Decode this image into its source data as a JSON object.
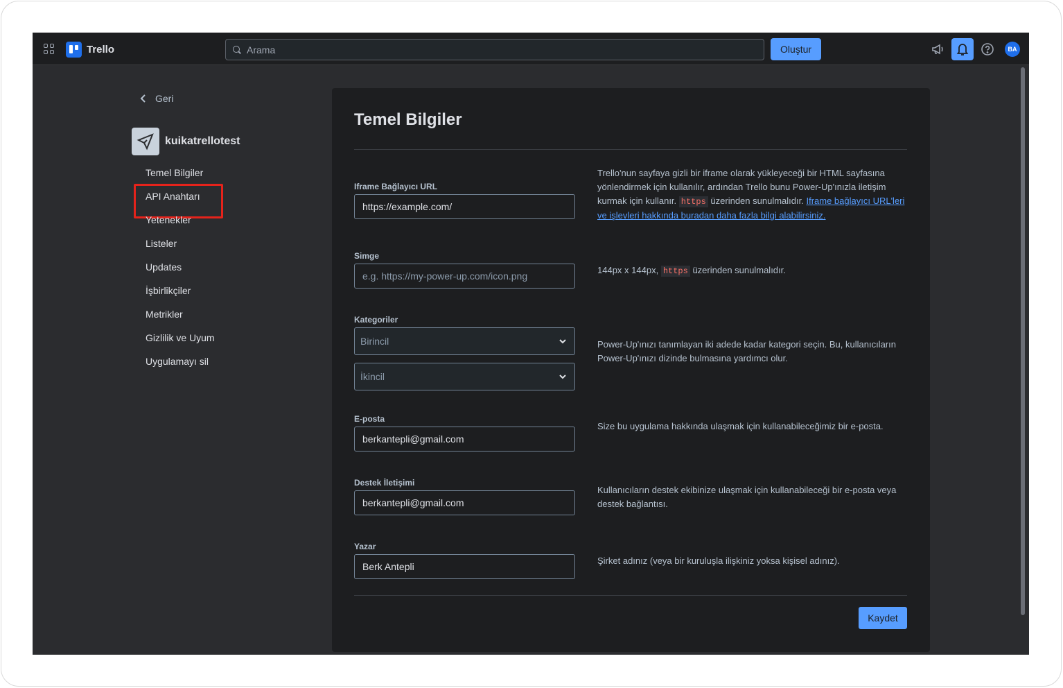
{
  "topbar": {
    "app_name": "Trello",
    "search_placeholder": "Arama",
    "create_label": "Oluştur",
    "avatar_initials": "BA"
  },
  "sidebar": {
    "back_label": "Geri",
    "app_name": "kuikatrellotest",
    "items": [
      {
        "label": "Temel Bilgiler"
      },
      {
        "label": "API Anahtarı"
      },
      {
        "label": "Yetenekler"
      },
      {
        "label": "Listeler"
      },
      {
        "label": "Updates"
      },
      {
        "label": "İşbirlikçiler"
      },
      {
        "label": "Metrikler"
      },
      {
        "label": "Gizlilik ve Uyum"
      },
      {
        "label": "Uygulamayı sil"
      }
    ]
  },
  "main": {
    "title": "Temel Bilgiler",
    "iframe": {
      "label": "Iframe Bağlayıcı URL",
      "value": "https://example.com/",
      "help_text": "Trello'nun sayfaya gizli bir iframe olarak yükleyeceği bir HTML sayfasına yönlendirmek için kullanılır, ardından Trello bunu Power-Up'ınızla iletişim kurmak için kullanır.",
      "help_code": "https",
      "help_suffix": "üzerinden sunulmalıdır.",
      "help_link": "Iframe bağlayıcı URL'leri ve işlevleri hakkında buradan daha fazla bilgi alabilirsiniz."
    },
    "icon": {
      "label": "Simge",
      "placeholder": "e.g. https://my-power-up.com/icon.png",
      "help_prefix": "144px x 144px,",
      "help_code": "https",
      "help_suffix": "üzerinden sunulmalıdır."
    },
    "categories": {
      "label": "Kategoriler",
      "primary": "Birincil",
      "secondary": "İkincil",
      "help_text": "Power-Up'ınızı tanımlayan iki adede kadar kategori seçin. Bu, kullanıcıların Power-Up'ınızı dizinde bulmasına yardımcı olur."
    },
    "email": {
      "label": "E-posta",
      "value": "berkantepli@gmail.com",
      "help_text": "Size bu uygulama hakkında ulaşmak için kullanabileceğimiz bir e-posta."
    },
    "support": {
      "label": "Destek İletişimi",
      "value": "berkantepli@gmail.com",
      "help_text": "Kullanıcıların destek ekibinize ulaşmak için kullanabileceği bir e-posta veya destek bağlantısı."
    },
    "author": {
      "label": "Yazar",
      "value": "Berk Antepli",
      "help_text": "Şirket adınız (veya bir kuruluşla ilişkiniz yoksa kişisel adınız)."
    },
    "save_label": "Kaydet"
  }
}
